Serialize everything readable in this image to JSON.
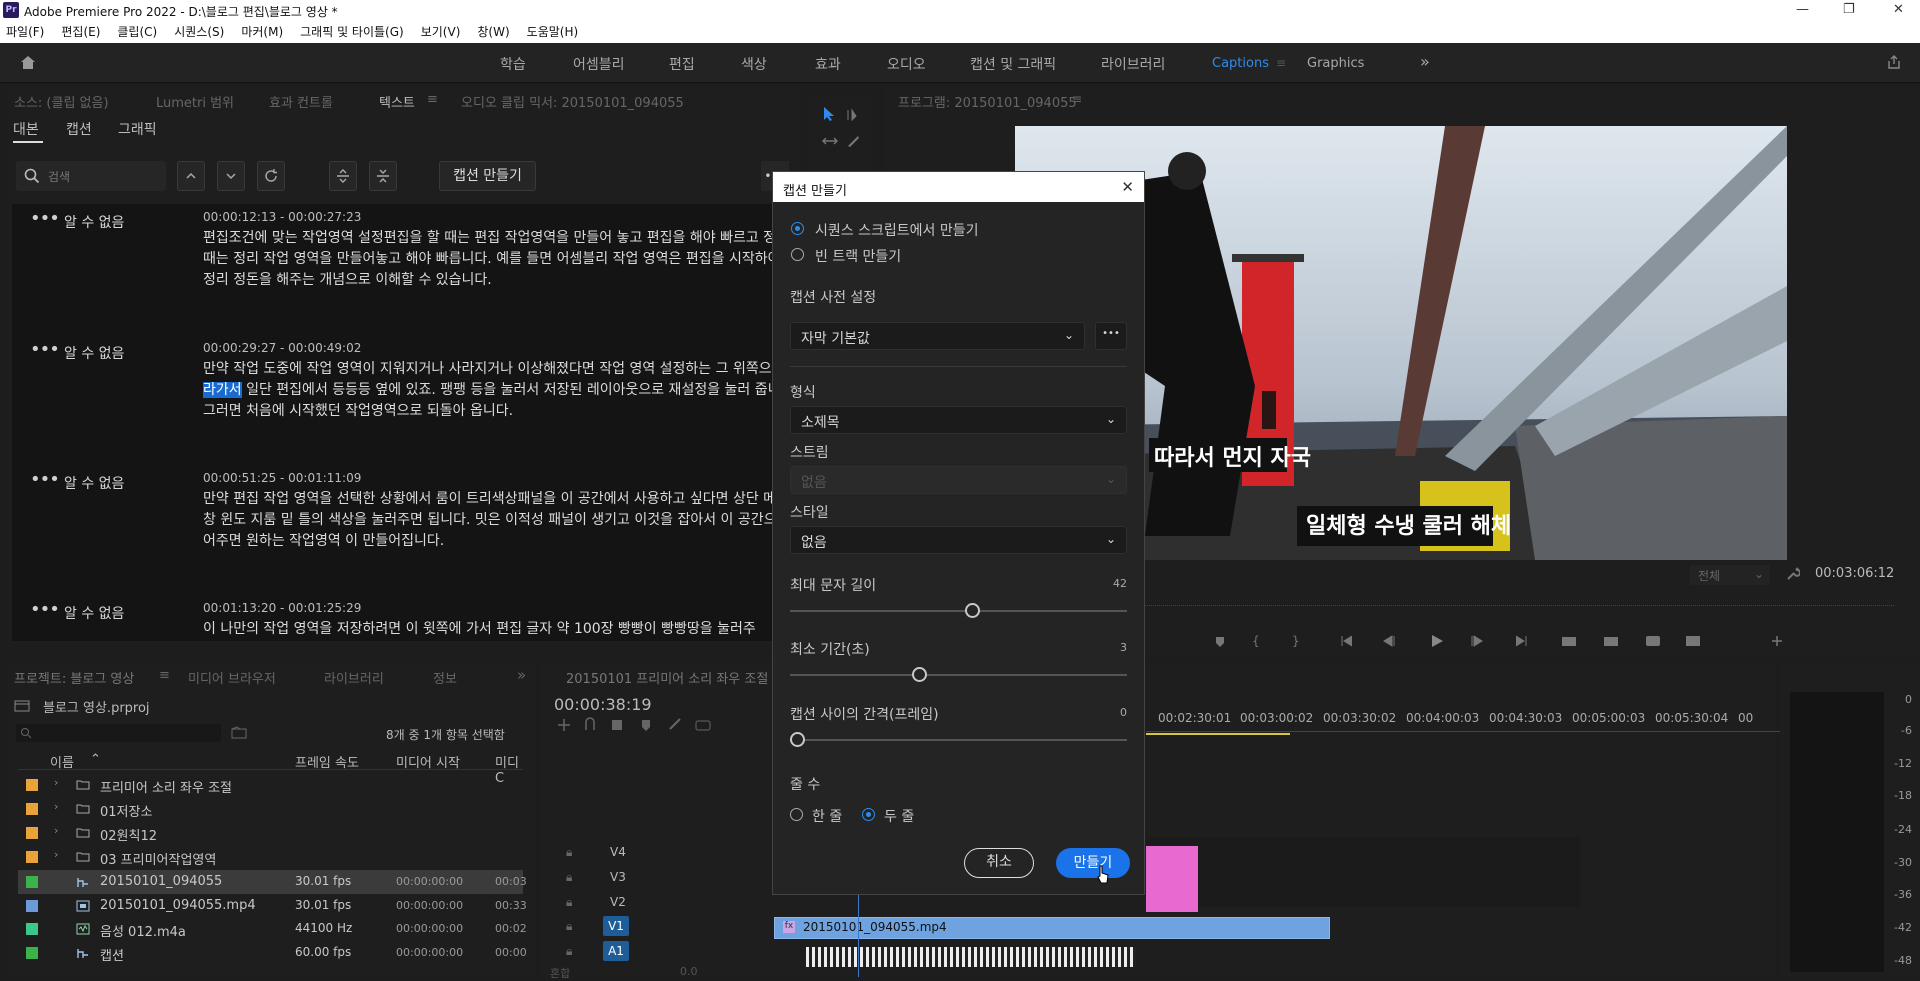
{
  "window": {
    "title": "Adobe Premiere Pro 2022 - D:\\블로그 편집\\블로그 영상 *",
    "app_badge": "Pr",
    "controls": {
      "minimize": "—",
      "restore": "❐",
      "close": "✕"
    }
  },
  "menu": [
    "파일(F)",
    "편집(E)",
    "클립(C)",
    "시퀀스(S)",
    "마커(M)",
    "그래픽 및 타이틀(G)",
    "보기(V)",
    "창(W)",
    "도움말(H)"
  ],
  "workspaces": {
    "items": [
      "학습",
      "어셈블리",
      "편집",
      "색상",
      "효과",
      "오디오",
      "캡션 및 그래픽",
      "라이브러리",
      "Captions",
      "Graphics"
    ],
    "active": "Captions",
    "more": "»"
  },
  "source_panel": {
    "tabs": [
      "소스: (클립 없음)",
      "Lumetri 범위",
      "효과 컨트롤",
      "텍스트",
      "오디오 클립 믹서: 20150101_094055"
    ],
    "active_tab": "텍스트",
    "subtabs": [
      "대본",
      "캡션",
      "그래픽"
    ],
    "active_subtab": "대본",
    "search_placeholder": "검색",
    "create_captions_button": "캡션 만들기",
    "entries": [
      {
        "speaker": "알 수 없음",
        "time": "00:00:12:13 - 00:00:27:23",
        "text": "편집조건에 맞는 작업영역 설정편집을 할 때는 편집 작업영역을 만들어 놓고 편집을 해야 빠르고 정리할 때는 정리 작업 영역을 만들어놓고 해야 빠릅니다. 예를 들면 어셈블리 작업 영역은 편집을 시작하여 직접 정리 정돈을 해주는 개념으로 이해할 수 있습니다."
      },
      {
        "speaker": "알 수 없음",
        "time": "00:00:29:27 - 00:00:49:02",
        "text_before": "만약 작업 도중에 작업 영역이 지워지거나 사라지거나 이상해졌다면 작업 영역 설정하는 그 위쪽으로 ",
        "highlight": "올라가서",
        "text_after": " 일단 편집에서 등등등 옆에 있죠. 팽팽 등을 눌러서 저장된 레이아웃으로 재설정을 눌러 줍니다. 그러면 처음에 시작했던 작업영역으로 되돌아 옵니다."
      },
      {
        "speaker": "알 수 없음",
        "time": "00:00:51:25 - 00:01:11:09",
        "text": "만약 편집 작업 영역을 선택한 상황에서 룸이 트리색상패널을 이 공간에서 사용하고 싶다면 상단 메뉴 바창 윈도 지룸 밑 틀의 색상을 눌러주면 됩니다. 밋은 이적성 패널이 생기고 이것을 잡아서 이 공간으로 끌어주면 원하는 작업영역 이 만들어집니다."
      },
      {
        "speaker": "알 수 없음",
        "time": "00:01:13:20 - 00:01:25:29",
        "text": "이 나만의 작업 영역을 저장하려면 이 윗쪽에 가서 편집 글자 약 100장 빵빵이 빵빵땅을 눌러주"
      }
    ]
  },
  "program_monitor": {
    "tab": "프로그램: 20150101_094055",
    "caption_line1": "따라서 먼지 자국",
    "caption_line2": "일체형 수냉 쿨러 해체",
    "zoom": "전체",
    "timecode": "00:03:06:12"
  },
  "dialog": {
    "title": "캡션 만들기",
    "close": "✕",
    "source_options": [
      "시퀀스 스크립트에서 만들기",
      "빈 트랙 만들기"
    ],
    "selected_source": 0,
    "preset_label": "캡션 사전 설정",
    "preset_value": "자막 기본값",
    "format_label": "형식",
    "format_value": "소제목",
    "stream_label": "스트림",
    "stream_value": "없음",
    "style_label": "스타일",
    "style_value": "없음",
    "max_chars_label": "최대 문자 길이",
    "max_chars": 42,
    "min_duration_label": "최소 기간(초)",
    "min_duration": 3,
    "gap_label": "캡션 사이의 간격(프레임)",
    "gap": 0,
    "lines_label": "줄 수",
    "line_options": [
      "한 줄",
      "두 줄"
    ],
    "selected_lines": 1,
    "cancel": "취소",
    "create": "만들기",
    "more": "•••"
  },
  "project_panel": {
    "tabs": [
      "프로젝트: 블로그 영상",
      "미디어 브라우저",
      "라이브러리",
      "정보"
    ],
    "file": "블로그 영상.prproj",
    "selection": "8개 중 1개 항목 선택함",
    "columns": [
      "이름",
      "프레임 속도",
      "미디어 시작",
      "미디C"
    ],
    "rows": [
      {
        "name": "프리미어 소리 좌우 조절",
        "fps": "",
        "start": "",
        "dur": "",
        "color": "#e8a33b",
        "type": "folder"
      },
      {
        "name": "01저장소",
        "fps": "",
        "start": "",
        "dur": "",
        "color": "#e8a33b",
        "type": "folder"
      },
      {
        "name": "02원칙12",
        "fps": "",
        "start": "",
        "dur": "",
        "color": "#e8a33b",
        "type": "folder"
      },
      {
        "name": "03 프리미어작업영역",
        "fps": "",
        "start": "",
        "dur": "",
        "color": "#e8a33b",
        "type": "folder"
      },
      {
        "name": "20150101_094055",
        "fps": "30.01 fps",
        "start": "00:00:00:00",
        "dur": "00:03",
        "color": "#3bb34a",
        "type": "sequence"
      },
      {
        "name": "20150101_094055.mp4",
        "fps": "30.01 fps",
        "start": "00:00:00:00",
        "dur": "00:33",
        "color": "#6d9bd9",
        "type": "video"
      },
      {
        "name": "음성 012.m4a",
        "fps": "44100 Hz",
        "start": "00:00:00:00",
        "dur": "00:02",
        "color": "#3bc98a",
        "type": "audio"
      },
      {
        "name": "캡션",
        "fps": "60.00 fps",
        "start": "00:00:00:00",
        "dur": "00:00",
        "color": "#3bb34a",
        "type": "sequence"
      }
    ]
  },
  "timeline": {
    "tab": "20150101 프리미어 소리 좌우 조절",
    "timecode": "00:00:38:19",
    "ruler": [
      "00:02:30:01",
      "00:03:00:02",
      "00:03:30:02",
      "00:04:00:03",
      "00:04:30:03",
      "00:05:00:03",
      "00:05:30:04",
      "00"
    ],
    "tracks": [
      "V4",
      "V3",
      "V2",
      "V1",
      "A1"
    ],
    "clip": "20150101_094055.mp4",
    "mix_label": "혼합",
    "mix_value": "0.0"
  },
  "meter": [
    "0",
    "-6",
    "-12",
    "-18",
    "-24",
    "-30",
    "-36",
    "-42",
    "-48"
  ]
}
